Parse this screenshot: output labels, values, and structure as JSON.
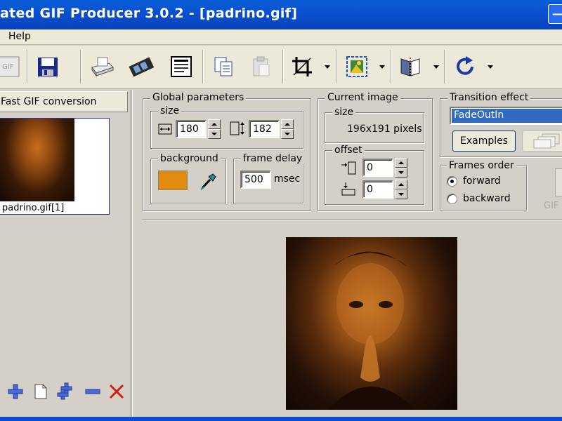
{
  "window": {
    "title": "ated GIF Producer 3.0.2 - [padrino.gif]"
  },
  "menu": {
    "items": [
      "Help"
    ]
  },
  "toolbar": {
    "icons": [
      "gif-icon",
      "save-icon",
      "print-icon",
      "film-icon",
      "document-icon",
      "copy-icon",
      "paste-icon",
      "crop-icon",
      "resize-icon",
      "flip-icon",
      "rotate-icon"
    ]
  },
  "left": {
    "fast_conversion_label": "Fast GIF conversion",
    "frame_caption": "padrino.gif[1]"
  },
  "global": {
    "title": "Global parameters",
    "size_label": "size",
    "width": "180",
    "height": "182",
    "background_label": "background",
    "background_color": "#e08a10",
    "frame_delay_label": "frame delay",
    "frame_delay": "500",
    "frame_delay_unit": "msec"
  },
  "current": {
    "title": "Current image",
    "size_label": "size",
    "size_value": "196x191 pixels",
    "offset_label": "offset",
    "offset_x": "0",
    "offset_y": "0"
  },
  "transition": {
    "title": "Transition effect",
    "selected": "FadeOutIn",
    "examples_label": "Examples"
  },
  "order": {
    "title": "Frames order",
    "forward_label": "forward",
    "backward_label": "backward",
    "selected": "forward"
  },
  "gif_label": "GIF"
}
